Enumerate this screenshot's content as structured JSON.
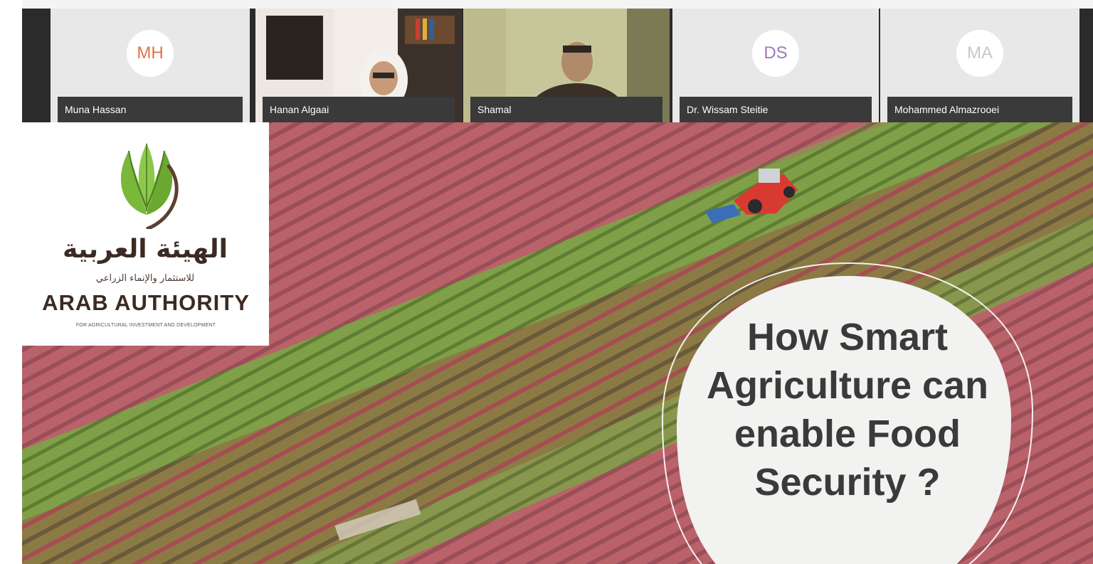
{
  "participants": [
    {
      "initials": "MH",
      "name": "Muna Hassan",
      "video": false,
      "initials_color": "#e0704a"
    },
    {
      "initials": "",
      "name": "Hanan Algaai",
      "video": true
    },
    {
      "initials": "",
      "name": "Shamal",
      "video": true
    },
    {
      "initials": "DS",
      "name": "Dr. Wissam Steitie",
      "video": false,
      "initials_color": "#a07ab8"
    },
    {
      "initials": "MA",
      "name": "Mohammed Almazrooei",
      "video": false,
      "initials_color": "#c9c9c9"
    }
  ],
  "slide": {
    "logo": {
      "arabic_title": "الهيئة العربية",
      "arabic_subtitle": "للاستثمار والإنماء الزراعي",
      "name": "ARAB AUTHORITY",
      "subtitle": "FOR AGRICULTURAL INVESTMENT AND DEVELOPMENT",
      "leaf_color": "#7ab83a",
      "stem_color": "#5a4030"
    },
    "headline_lines": [
      "How Smart",
      "Agriculture can",
      "enable Food",
      "Security ?"
    ],
    "colors": {
      "pink_row": "#b9626a",
      "green_row": "#7fa048",
      "dark_row": "#6a5a3a"
    }
  }
}
